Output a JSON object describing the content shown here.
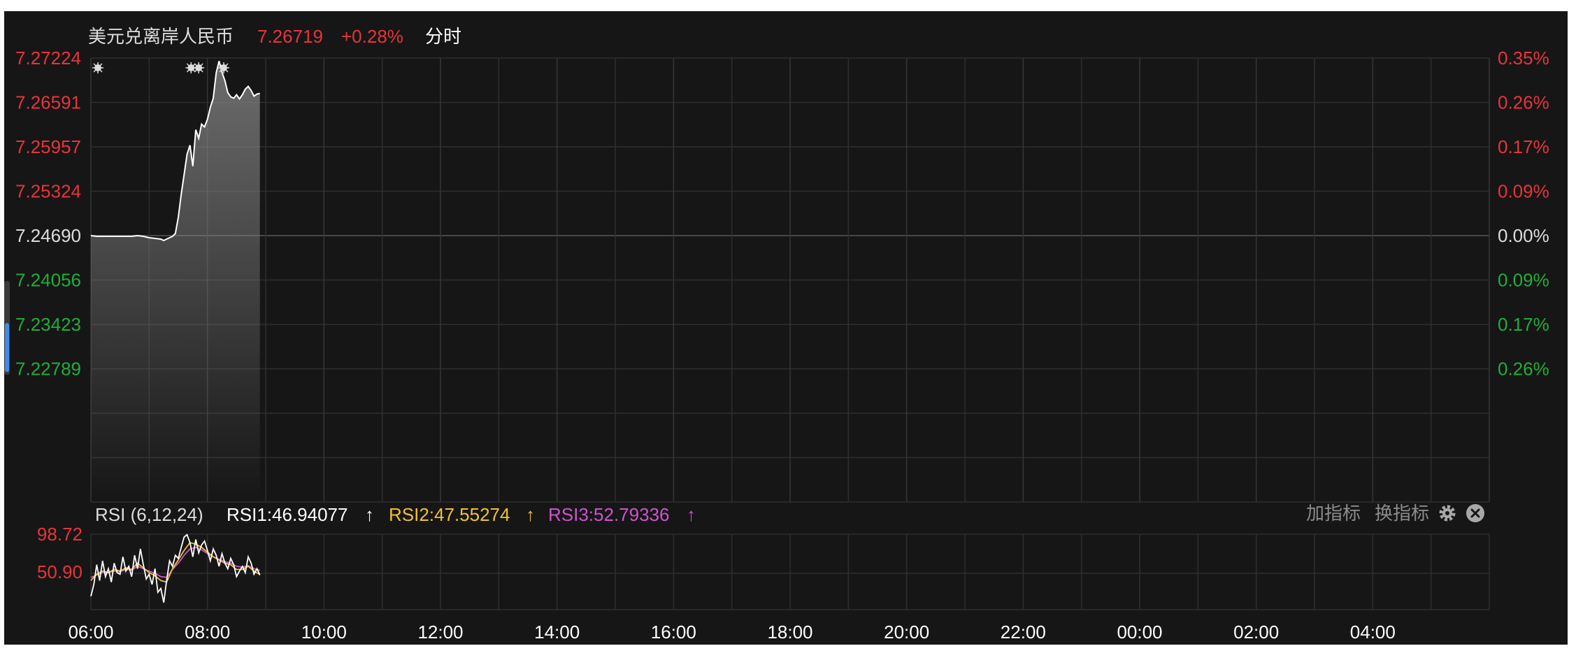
{
  "header": {
    "instrument": "美元兑离岸人民币",
    "price": "7.26719",
    "change": "+0.28%",
    "mode": "分时"
  },
  "indicator": {
    "name": "RSI (6,12,24)",
    "rsi1": "RSI1:46.94077",
    "rsi2": "RSI2:47.55274",
    "rsi3": "RSI3:52.79336",
    "arrow": "↑",
    "add_label": "加指标",
    "switch_label": "换指标",
    "settings_icon": "gear-icon",
    "close_icon": "close-icon"
  },
  "colors": {
    "up": "#e8343a",
    "down": "#1fae3a",
    "neutral": "#dddddd",
    "rsi1": "#ffffff",
    "rsi2": "#f1c232",
    "rsi3": "#cc55cc",
    "bg": "#161616",
    "grid": "#2e2e2e"
  },
  "chart_data": [
    {
      "type": "line",
      "name": "price",
      "ylim": [
        7.22155,
        7.27224
      ],
      "y_ticks_left": [
        {
          "label": "7.27224",
          "value": 7.27224,
          "trend": "up"
        },
        {
          "label": "7.26591",
          "value": 7.26591,
          "trend": "up"
        },
        {
          "label": "7.25957",
          "value": 7.25957,
          "trend": "up"
        },
        {
          "label": "7.25324",
          "value": 7.25324,
          "trend": "up"
        },
        {
          "label": "7.24690",
          "value": 7.2469,
          "trend": "flat"
        },
        {
          "label": "7.24056",
          "value": 7.24056,
          "trend": "down"
        },
        {
          "label": "7.23423",
          "value": 7.23423,
          "trend": "down"
        },
        {
          "label": "7.22789",
          "value": 7.22789,
          "trend": "down"
        }
      ],
      "y_ticks_right": [
        {
          "label": "0.35%",
          "trend": "up"
        },
        {
          "label": "0.26%",
          "trend": "up"
        },
        {
          "label": "0.17%",
          "trend": "up"
        },
        {
          "label": "0.09%",
          "trend": "up"
        },
        {
          "label": "0.00%",
          "trend": "flat"
        },
        {
          "label": "0.09%",
          "trend": "down"
        },
        {
          "label": "0.17%",
          "trend": "down"
        },
        {
          "label": "0.26%",
          "trend": "down"
        }
      ],
      "x_ticks": [
        "06:00",
        "08:00",
        "10:00",
        "12:00",
        "14:00",
        "16:00",
        "18:00",
        "20:00",
        "22:00",
        "00:00",
        "02:00",
        "04:00"
      ],
      "xlim_hours": [
        0,
        24
      ],
      "grid": true,
      "series": [
        {
          "x": [
            0,
            0.1,
            0.3,
            0.5,
            0.7,
            0.8,
            0.9,
            1.0,
            1.1,
            1.2,
            1.25,
            1.3,
            1.35,
            1.4,
            1.45,
            1.5,
            1.55,
            1.6,
            1.65,
            1.7,
            1.75,
            1.8,
            1.85,
            1.9,
            1.95,
            2.0,
            2.05,
            2.1,
            2.15,
            2.2,
            2.25,
            2.3,
            2.35,
            2.4,
            2.45,
            2.5,
            2.55,
            2.6,
            2.65,
            2.7,
            2.75,
            2.8,
            2.85,
            2.9
          ],
          "y": [
            7.2469,
            7.2468,
            7.2468,
            7.2468,
            7.2468,
            7.2469,
            7.2468,
            7.2466,
            7.2465,
            7.2464,
            7.2462,
            7.2464,
            7.2466,
            7.2468,
            7.2472,
            7.2495,
            7.2528,
            7.2556,
            7.2585,
            7.2598,
            7.2568,
            7.262,
            7.2608,
            7.2628,
            7.2624,
            7.2635,
            7.2652,
            7.2665,
            7.2701,
            7.2718,
            7.2702,
            7.269,
            7.2673,
            7.2667,
            7.2665,
            7.267,
            7.2664,
            7.267,
            7.2678,
            7.2682,
            7.2676,
            7.2668,
            7.2671,
            7.26719
          ]
        }
      ],
      "markers_x": [
        0.12,
        1.72,
        1.85,
        2.28
      ]
    },
    {
      "type": "line",
      "name": "RSI",
      "y_ticks": [
        {
          "label": "98.72",
          "value": 98.72
        },
        {
          "label": "50.90",
          "value": 50.9
        }
      ],
      "ylim": [
        3.08,
        98.72
      ],
      "xlim_hours": [
        0,
        24
      ],
      "series": [
        {
          "name": "RSI1",
          "x": [
            0,
            0.05,
            0.1,
            0.15,
            0.2,
            0.25,
            0.3,
            0.35,
            0.4,
            0.45,
            0.5,
            0.55,
            0.6,
            0.65,
            0.7,
            0.75,
            0.8,
            0.85,
            0.9,
            0.95,
            1.0,
            1.05,
            1.1,
            1.15,
            1.2,
            1.25,
            1.3,
            1.35,
            1.4,
            1.45,
            1.5,
            1.55,
            1.6,
            1.65,
            1.7,
            1.75,
            1.8,
            1.85,
            1.9,
            1.95,
            2.0,
            2.05,
            2.1,
            2.15,
            2.2,
            2.25,
            2.3,
            2.35,
            2.4,
            2.45,
            2.5,
            2.55,
            2.6,
            2.65,
            2.7,
            2.75,
            2.8,
            2.85,
            2.9
          ],
          "y": [
            20,
            35,
            60,
            40,
            65,
            45,
            55,
            38,
            62,
            50,
            48,
            70,
            52,
            58,
            45,
            72,
            55,
            80,
            60,
            42,
            48,
            35,
            55,
            25,
            30,
            12,
            40,
            65,
            58,
            72,
            68,
            82,
            95,
            98,
            88,
            70,
            92,
            75,
            85,
            90,
            78,
            65,
            80,
            72,
            58,
            74,
            62,
            55,
            68,
            60,
            45,
            52,
            58,
            50,
            70,
            62,
            48,
            55,
            46.94
          ]
        },
        {
          "name": "RSI2",
          "x": [
            0,
            0.1,
            0.2,
            0.3,
            0.4,
            0.5,
            0.6,
            0.7,
            0.8,
            0.9,
            1.0,
            1.1,
            1.2,
            1.3,
            1.4,
            1.5,
            1.6,
            1.7,
            1.8,
            1.9,
            2.0,
            2.1,
            2.2,
            2.3,
            2.4,
            2.5,
            2.6,
            2.7,
            2.8,
            2.9
          ],
          "y": [
            40,
            48,
            52,
            50,
            54,
            52,
            56,
            54,
            62,
            56,
            50,
            46,
            40,
            38,
            55,
            66,
            78,
            88,
            86,
            82,
            76,
            70,
            66,
            62,
            60,
            54,
            54,
            58,
            52,
            47.55
          ]
        },
        {
          "name": "RSI3",
          "x": [
            0,
            0.1,
            0.2,
            0.3,
            0.4,
            0.5,
            0.6,
            0.7,
            0.8,
            0.9,
            1.0,
            1.1,
            1.2,
            1.3,
            1.4,
            1.5,
            1.6,
            1.7,
            1.8,
            1.9,
            2.0,
            2.1,
            2.2,
            2.3,
            2.4,
            2.5,
            2.6,
            2.7,
            2.8,
            2.9
          ],
          "y": [
            44,
            47,
            50,
            50,
            52,
            51,
            54,
            53,
            58,
            55,
            52,
            49,
            45,
            44,
            54,
            62,
            72,
            80,
            82,
            79,
            74,
            70,
            67,
            64,
            62,
            58,
            57,
            59,
            55,
            52.79
          ]
        }
      ]
    }
  ]
}
